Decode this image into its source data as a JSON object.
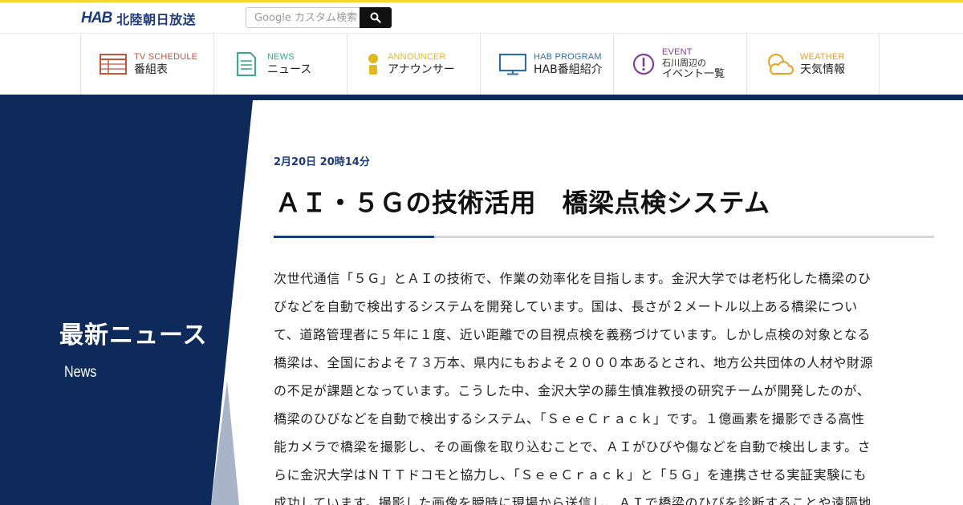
{
  "header": {
    "logo_mark": "HAB",
    "logo_text": "北陸朝日放送",
    "search_placeholder": "Google カスタム検索"
  },
  "nav": [
    {
      "en": "TV SCHEDULE",
      "ja": "番組表",
      "icon": "tv-schedule-icon",
      "color": "#c9523a"
    },
    {
      "en": "NEWS",
      "ja": "ニュース",
      "icon": "news-icon",
      "color": "#3aa88a"
    },
    {
      "en": "ANNOUNCER",
      "ja": "アナウンサー",
      "icon": "announcer-icon",
      "color": "#e0b820"
    },
    {
      "en": "HAB PROGRAM",
      "ja": "HAB番組紹介",
      "icon": "tv-icon",
      "color": "#2f6fa8"
    },
    {
      "en": "EVENT",
      "ja_small": "石川周辺の",
      "ja": "イベント一覧",
      "icon": "event-icon",
      "color": "#8a3a9a"
    },
    {
      "en": "WEATHER",
      "ja": "天気情報",
      "icon": "weather-icon",
      "color": "#e8a020"
    }
  ],
  "section": {
    "title": "最新ニュース",
    "subtitle": "News"
  },
  "article": {
    "date": "2月20日 20時14分",
    "title": "ＡＩ・５Ｇの技術活用　橋梁点検システム",
    "lines": [
      "次世代通信「５Ｇ」とＡＩの技術で、作業の効率化を目指します。金沢大学では老朽化した橋梁のひ",
      "びなどを自動で検出するシステムを開発しています。国は、長さが２メートル以上ある橋梁につい",
      "て、道路管理者に５年に１度、近い距離での目視点検を義務づけています。しかし点検の対象となる",
      "橋梁は、全国におよそ７３万本、県内にもおよそ２０００本あるとされ、地方公共団体の人材や財源",
      "の不足が課題となっています。こうした中、金沢大学の藤生慎准教授の研究チームが開発したのが、",
      "橋梁のひびなどを自動で検出するシステム、「ＳｅｅＣｒａｃｋ」です。１億画素を撮影できる高性",
      "能カメラで橋梁を撮影し、その画像を取り込むことで、ＡＩがひびや傷などを自動で検出します。さ",
      "らに金沢大学はＮＴＴドコモと協力し、「ＳｅｅＣｒａｃｋ」と「５Ｇ」を連携させる実証実験にも",
      "成功しています。撮影した画像を瞬時に現場から送信し、ＡＩで橋梁のひびを診断することや遠隔地"
    ]
  },
  "colors": {
    "navy": "#0e2a5a",
    "accent_yellow": "#f2d62d",
    "link_blue": "#1b3a7a",
    "panel_gray": "#a9b4c8"
  }
}
